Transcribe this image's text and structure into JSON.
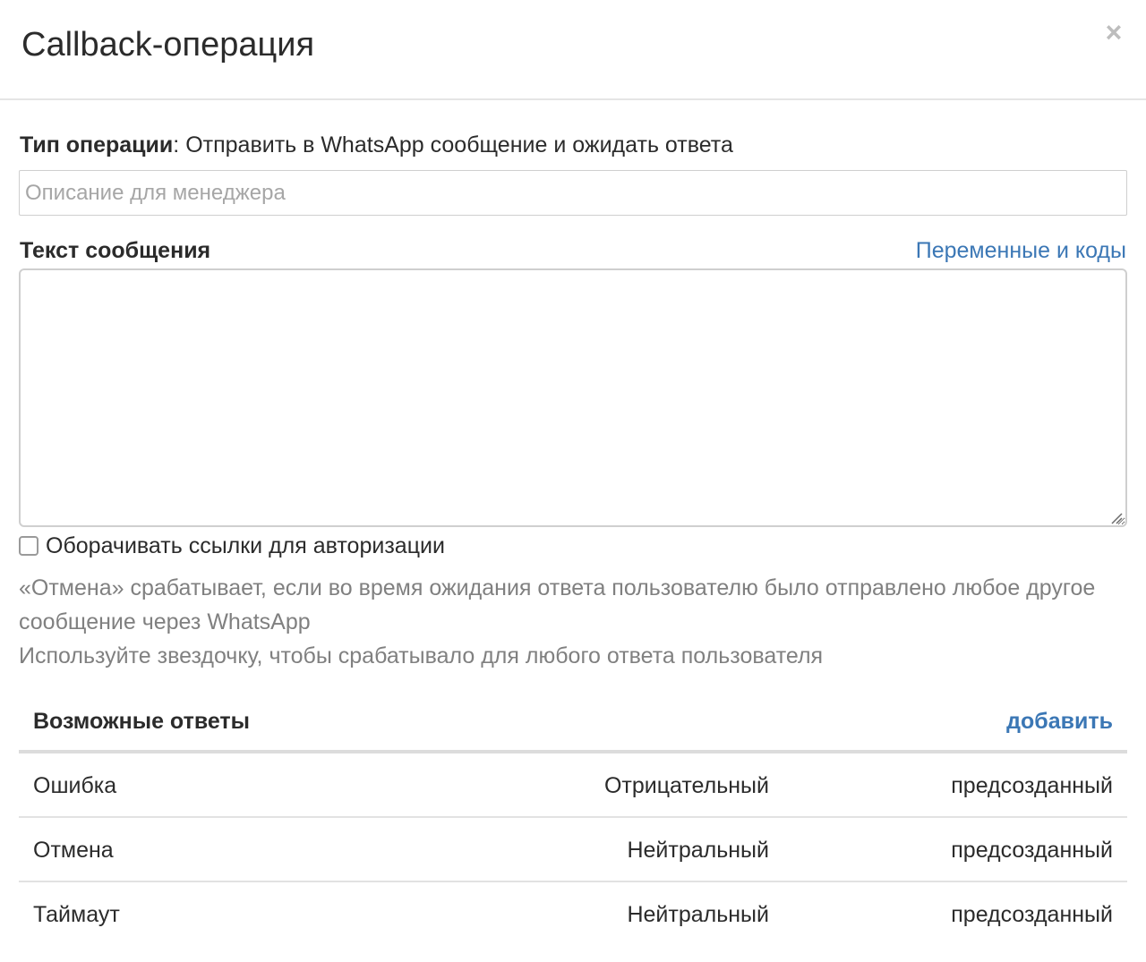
{
  "modal": {
    "title": "Callback-операция",
    "close_symbol": "×"
  },
  "operation": {
    "type_label": "Тип операции",
    "type_separator": ": ",
    "type_value": "Отправить в WhatsApp сообщение и ожидать ответа"
  },
  "description_input": {
    "placeholder": "Описание для менеджера",
    "value": ""
  },
  "message": {
    "label": "Текст сообщения",
    "vars_link": "Переменные и коды",
    "value": ""
  },
  "wrap_links": {
    "label": "Оборачивать ссылки для авторизации",
    "checked": false
  },
  "hints": {
    "cancel_hint": "«Отмена» срабатывает, если во время ожидания ответа пользователю было отправлено любое другое сообщение через WhatsApp",
    "asterisk_hint": "Используйте звездочку, чтобы срабатывало для любого ответа пользователя"
  },
  "answers": {
    "title": "Возможные ответы",
    "add_label": "добавить",
    "rows": [
      {
        "name": "Ошибка",
        "type": "Отрицательный",
        "origin": "предсозданный"
      },
      {
        "name": "Отмена",
        "type": "Нейтральный",
        "origin": "предсозданный"
      },
      {
        "name": "Таймаут",
        "type": "Нейтральный",
        "origin": "предсозданный"
      }
    ]
  },
  "colors": {
    "link": "#3b77b5",
    "hint_text": "#808080",
    "border": "#cfcfcf"
  }
}
